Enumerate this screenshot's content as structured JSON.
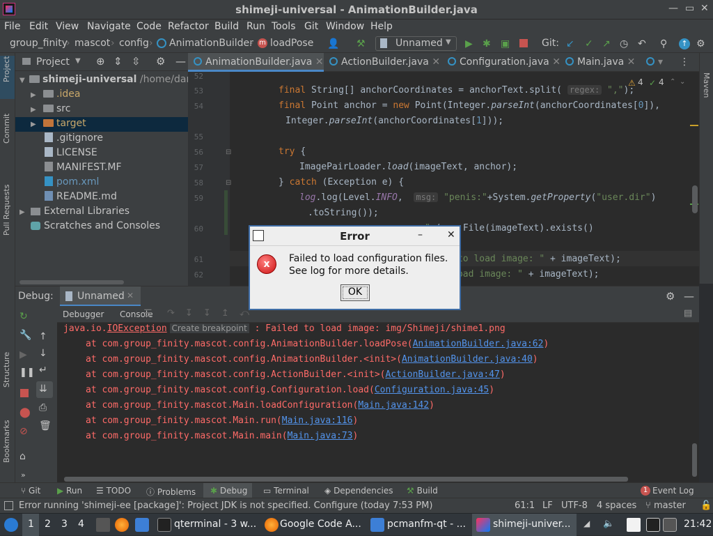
{
  "window": {
    "title": "shimeji-universal - AnimationBuilder.java",
    "minimize": "—",
    "restore": "▭",
    "close": "✕"
  },
  "menu": [
    "File",
    "Edit",
    "View",
    "Navigate",
    "Code",
    "Refactor",
    "Build",
    "Run",
    "Tools",
    "Git",
    "Window",
    "Help"
  ],
  "breadcrumbs": [
    "group_finity",
    "mascot",
    "config",
    "AnimationBuilder",
    "loadPose"
  ],
  "run_config": "Unnamed",
  "git_label": "Git:",
  "project": {
    "header": "Project",
    "root_name": "shimeji-universal",
    "root_path": "/home/dartz",
    "items": [
      ".idea",
      "src",
      "target",
      ".gitignore",
      "LICENSE",
      "MANIFEST.MF",
      "pom.xml",
      "README.md",
      "External Libraries",
      "Scratches and Consoles"
    ]
  },
  "left_tools": [
    "Project",
    "Commit",
    "Pull Requests",
    "Structure",
    "Bookmarks"
  ],
  "right_tools": [
    "Maven"
  ],
  "editor": {
    "tabs": [
      "AnimationBuilder.java",
      "ActionBuilder.java",
      "Configuration.java",
      "Main.java"
    ],
    "warnings": "4",
    "checks": "4",
    "line_numbers": [
      "52",
      "53",
      "54",
      "",
      "55",
      "56",
      "57",
      "58",
      "59",
      "",
      "60",
      "",
      "61",
      "62"
    ]
  },
  "debug": {
    "label": "Debug:",
    "config": "Unnamed",
    "tabs": [
      "Debugger",
      "Console"
    ],
    "tooltip": "Create breakpoint",
    "exception_prefix": "java.io.",
    "exception_class": "IOException",
    "exception_msg": " : Failed to load image: img/Shimeji/shime1.png",
    "trace": [
      {
        "text": "at com.group_finity.mascot.config.AnimationBuilder.loadPose(",
        "link": "AnimationBuilder.java:62"
      },
      {
        "text": "at com.group_finity.mascot.config.AnimationBuilder.<init>(",
        "link": "AnimationBuilder.java:40"
      },
      {
        "text": "at com.group_finity.mascot.config.ActionBuilder.<init>(",
        "link": "ActionBuilder.java:47"
      },
      {
        "text": "at com.group_finity.mascot.config.Configuration.load(",
        "link": "Configuration.java:45"
      },
      {
        "text": "at com.group_finity.mascot.Main.loadConfiguration(",
        "link": "Main.java:142"
      },
      {
        "text": "at com.group_finity.mascot.Main.run(",
        "link": "Main.java:116"
      },
      {
        "text": "at com.group_finity.mascot.Main.main(",
        "link": "Main.java:73"
      }
    ]
  },
  "bottom_tabs": [
    "Git",
    "Run",
    "TODO",
    "Problems",
    "Debug",
    "Terminal",
    "Dependencies",
    "Build"
  ],
  "event_log": {
    "count": "1",
    "label": "Event Log"
  },
  "status": {
    "message": "Error running 'shimeji-ee [package]': Project JDK is not specified. Configure (today 7:53 PM)",
    "position": "61:1",
    "line_sep": "LF",
    "encoding": "UTF-8",
    "indent": "4 spaces",
    "branch": "master"
  },
  "dialog": {
    "title": "Error",
    "line1": "Failed to load configuration files.",
    "line2": "See log for more details.",
    "ok": "OK",
    "min": "–",
    "close": "✕"
  },
  "taskbar": {
    "desktops": [
      "1",
      "2",
      "3",
      "4"
    ],
    "windows": [
      "qterminal - 3 w...",
      "Google Code A...",
      "pcmanfm-qt - ...",
      "shimeji-univer..."
    ],
    "clock": "21:42"
  },
  "colors": {
    "accent": "#4a88c7",
    "selection": "#0d293e",
    "error_text": "#ff6b68",
    "link": "#5394ec"
  }
}
